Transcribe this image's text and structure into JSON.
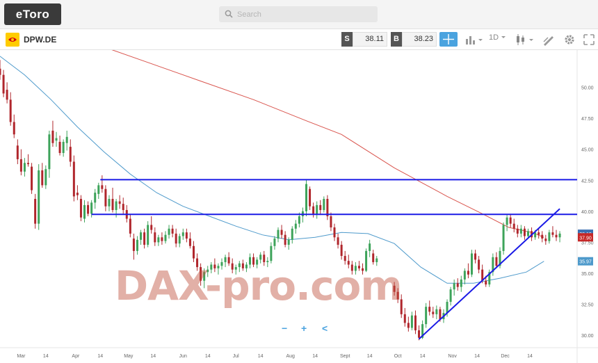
{
  "app": {
    "logo_text": "eToro"
  },
  "search": {
    "placeholder": "Search"
  },
  "instrument": {
    "symbol": "DPW.DE"
  },
  "trade": {
    "sell_label": "S",
    "sell_price": "38.11",
    "buy_label": "B",
    "buy_price": "38.23"
  },
  "toolbar": {
    "timeframe": "1D",
    "icons": [
      "crosshair-icon",
      "chart-type-icon",
      "candlestick-icon",
      "drawing-tool-icon",
      "settings-gear-icon",
      "expand-icon"
    ]
  },
  "watermark": {
    "text": "DAX-pro.com",
    "controls": [
      "−",
      "+",
      "<"
    ]
  },
  "colors": {
    "bull": "#3da35a",
    "bear": "#b0262c",
    "ma_short": "#4e9acb",
    "ma_long": "#d9544d",
    "trend": "#1a1ae6",
    "badge_price": "#c62828",
    "badge_last": "#3a6fb2",
    "badge_ma": "#4e9acb"
  },
  "chart_data": {
    "type": "candlestick",
    "ylim": [
      29.0,
      53.0
    ],
    "yticks": [
      "50.00",
      "47.50",
      "45.00",
      "42.50",
      "40.00",
      "37.50",
      "35.00",
      "32.50",
      "30.00"
    ],
    "ytick_values": [
      50,
      47.5,
      45,
      42.5,
      40,
      37.5,
      35,
      32.5,
      30
    ],
    "xticks": [
      "Mar",
      "14",
      "Apr",
      "14",
      "May",
      "14",
      "Jun",
      "14",
      "Jul",
      "14",
      "Aug",
      "14",
      "Sept",
      "14",
      "Oct",
      "14",
      "Nov",
      "14",
      "Dec",
      "14"
    ],
    "xtick_days": [
      28,
      42,
      59,
      73,
      89,
      103,
      120,
      134,
      150,
      164,
      181,
      195,
      212,
      226,
      242,
      256,
      273,
      287,
      303,
      317
    ],
    "x_range_days": [
      16,
      332
    ],
    "price_badges": [
      {
        "label": "38.19",
        "value": 38.19,
        "kind": "last"
      },
      {
        "label": "37.90",
        "value": 37.9,
        "kind": "price"
      },
      {
        "label": "35.97",
        "value": 35.97,
        "kind": "ma"
      }
    ],
    "horizontal_lines": [
      {
        "value": 42.55,
        "from_day": 73
      },
      {
        "value": 39.75,
        "from_day": 68
      }
    ],
    "trendline": {
      "from": [
        254,
        29.7
      ],
      "to": [
        334,
        40.2
      ]
    },
    "ma_short": [
      [
        16,
        52.5
      ],
      [
        30,
        51
      ],
      [
        45,
        49
      ],
      [
        60,
        46.8
      ],
      [
        75,
        44.8
      ],
      [
        90,
        43
      ],
      [
        105,
        41.5
      ],
      [
        120,
        40.4
      ],
      [
        135,
        39.6
      ],
      [
        150,
        38.8
      ],
      [
        165,
        38.1
      ],
      [
        180,
        37.7
      ],
      [
        195,
        37.9
      ],
      [
        210,
        38.3
      ],
      [
        225,
        38.2
      ],
      [
        240,
        37.4
      ],
      [
        255,
        35.5
      ],
      [
        270,
        34.2
      ],
      [
        285,
        34.2
      ],
      [
        300,
        34.6
      ],
      [
        315,
        35.1
      ],
      [
        325,
        35.97
      ]
    ],
    "ma_long": [
      [
        70,
        53.5
      ],
      [
        100,
        52
      ],
      [
        130,
        50.5
      ],
      [
        160,
        49
      ],
      [
        190,
        47.3
      ],
      [
        210,
        46.2
      ],
      [
        240,
        43.5
      ],
      [
        270,
        41.2
      ],
      [
        290,
        39.8
      ],
      [
        305,
        38.7
      ],
      [
        318,
        38.3
      ],
      [
        325,
        37.9
      ]
    ],
    "candles": [
      [
        16,
        51.5,
        52.2,
        50.6,
        51.0
      ],
      [
        18,
        51.0,
        51.4,
        49.2,
        49.5
      ],
      [
        20,
        49.8,
        50.4,
        48.7,
        49.0
      ],
      [
        22,
        49.0,
        49.6,
        46.9,
        47.2
      ],
      [
        24,
        47.2,
        47.8,
        45.9,
        46.2
      ],
      [
        26,
        45.3,
        45.8,
        43.8,
        44.2
      ],
      [
        28,
        44.2,
        45.0,
        42.9,
        43.2
      ],
      [
        30,
        43.2,
        44.3,
        42.8,
        43.9
      ],
      [
        32,
        43.9,
        44.6,
        43.6,
        43.8
      ],
      [
        34,
        43.6,
        43.9,
        41.4,
        41.7
      ],
      [
        36,
        41.0,
        41.4,
        38.6,
        39.0
      ],
      [
        38,
        39.0,
        43.8,
        38.5,
        43.3
      ],
      [
        40,
        43.3,
        43.9,
        41.9,
        42.1
      ],
      [
        42,
        42.1,
        43.7,
        41.8,
        43.4
      ],
      [
        44,
        43.4,
        46.5,
        42.7,
        46.2
      ],
      [
        46,
        46.5,
        47.3,
        45.2,
        45.5
      ],
      [
        48,
        45.7,
        46.4,
        45.2,
        45.9
      ],
      [
        50,
        45.6,
        46.1,
        44.5,
        44.7
      ],
      [
        52,
        44.7,
        45.8,
        44.4,
        45.6
      ],
      [
        54,
        45.5,
        46.5,
        44.9,
        46.0
      ],
      [
        56,
        45.2,
        45.8,
        43.6,
        44.0
      ],
      [
        58,
        44.0,
        44.5,
        40.8,
        41.2
      ],
      [
        60,
        41.5,
        42.1,
        40.9,
        41.3
      ],
      [
        62,
        41.0,
        41.3,
        39.2,
        39.5
      ],
      [
        64,
        39.4,
        40.9,
        39.1,
        40.5
      ],
      [
        66,
        40.5,
        40.8,
        39.6,
        39.8
      ],
      [
        68,
        39.8,
        40.9,
        39.5,
        40.7
      ],
      [
        70,
        40.7,
        41.8,
        40.2,
        41.5
      ],
      [
        72,
        41.4,
        42.3,
        41.0,
        42.1
      ],
      [
        74,
        42.1,
        42.9,
        41.5,
        41.8
      ],
      [
        76,
        41.8,
        42.1,
        40.0,
        40.4
      ],
      [
        78,
        40.4,
        41.3,
        40.0,
        41.0
      ],
      [
        80,
        41.0,
        41.9,
        39.9,
        40.1
      ],
      [
        82,
        40.1,
        41.0,
        39.5,
        40.8
      ],
      [
        84,
        40.8,
        41.3,
        40.2,
        40.6
      ],
      [
        86,
        40.6,
        41.1,
        39.8,
        40.1
      ],
      [
        88,
        40.1,
        40.5,
        39.1,
        39.4
      ],
      [
        90,
        39.4,
        39.8,
        37.9,
        38.2
      ],
      [
        92,
        37.8,
        38.2,
        36.1,
        36.8
      ],
      [
        94,
        36.8,
        38.0,
        36.5,
        37.7
      ],
      [
        96,
        37.7,
        38.5,
        37.3,
        38.3
      ],
      [
        98,
        38.3,
        38.6,
        37.0,
        37.3
      ],
      [
        100,
        37.3,
        39.2,
        37.1,
        38.9
      ],
      [
        102,
        38.9,
        39.6,
        38.2,
        38.5
      ],
      [
        104,
        38.3,
        38.7,
        37.2,
        37.5
      ],
      [
        106,
        37.5,
        38.1,
        37.2,
        37.9
      ],
      [
        108,
        37.9,
        38.3,
        37.3,
        37.6
      ],
      [
        110,
        37.6,
        38.4,
        37.4,
        38.1
      ],
      [
        112,
        38.1,
        38.9,
        37.8,
        38.6
      ],
      [
        114,
        38.6,
        38.9,
        37.9,
        38.2
      ],
      [
        116,
        38.2,
        38.6,
        37.1,
        37.4
      ],
      [
        118,
        37.4,
        38.2,
        37.1,
        38.0
      ],
      [
        120,
        38.0,
        38.6,
        37.7,
        38.3
      ],
      [
        122,
        38.3,
        38.6,
        37.5,
        37.8
      ],
      [
        124,
        37.8,
        38.3,
        37.0,
        37.2
      ],
      [
        126,
        37.2,
        37.6,
        35.9,
        36.2
      ],
      [
        128,
        36.2,
        36.6,
        35.2,
        35.5
      ],
      [
        130,
        35.5,
        35.8,
        34.0,
        34.4
      ],
      [
        132,
        34.4,
        35.4,
        33.8,
        35.1
      ],
      [
        134,
        35.1,
        35.6,
        34.7,
        35.3
      ],
      [
        136,
        35.3,
        35.9,
        35.0,
        35.7
      ],
      [
        138,
        35.7,
        36.2,
        35.1,
        35.4
      ],
      [
        140,
        35.4,
        35.8,
        34.9,
        35.6
      ],
      [
        142,
        35.6,
        36.2,
        35.3,
        35.9
      ],
      [
        144,
        35.9,
        36.5,
        35.5,
        36.3
      ],
      [
        146,
        36.3,
        36.7,
        35.6,
        35.8
      ],
      [
        148,
        35.8,
        36.2,
        35.0,
        35.3
      ],
      [
        150,
        35.3,
        35.7,
        34.9,
        35.5
      ],
      [
        152,
        35.5,
        36.0,
        35.1,
        35.8
      ],
      [
        154,
        35.8,
        36.1,
        35.2,
        35.4
      ],
      [
        156,
        35.4,
        35.9,
        35.1,
        35.7
      ],
      [
        158,
        35.7,
        36.6,
        35.4,
        36.3
      ],
      [
        160,
        36.3,
        36.6,
        35.5,
        35.7
      ],
      [
        162,
        35.7,
        36.3,
        35.4,
        36.1
      ],
      [
        164,
        36.1,
        36.7,
        35.8,
        36.5
      ],
      [
        166,
        36.5,
        36.8,
        35.6,
        35.9
      ],
      [
        168,
        35.9,
        36.3,
        35.5,
        36.0
      ],
      [
        170,
        36.0,
        37.5,
        35.8,
        37.2
      ],
      [
        172,
        37.2,
        38.0,
        36.9,
        37.8
      ],
      [
        174,
        37.8,
        38.7,
        37.5,
        38.5
      ],
      [
        176,
        38.5,
        38.9,
        37.8,
        38.1
      ],
      [
        178,
        38.1,
        38.4,
        37.1,
        37.3
      ],
      [
        180,
        37.3,
        37.9,
        36.9,
        37.7
      ],
      [
        182,
        37.7,
        38.8,
        37.4,
        38.6
      ],
      [
        184,
        38.6,
        39.3,
        38.2,
        39.0
      ],
      [
        186,
        39.0,
        39.9,
        38.7,
        39.6
      ],
      [
        188,
        39.6,
        40.3,
        39.1,
        40.0
      ],
      [
        190,
        40.0,
        42.6,
        39.6,
        42.2
      ],
      [
        192,
        41.8,
        42.0,
        40.1,
        40.4
      ],
      [
        194,
        40.4,
        40.7,
        39.5,
        39.8
      ],
      [
        196,
        39.8,
        40.8,
        39.4,
        40.5
      ],
      [
        198,
        40.5,
        40.9,
        39.7,
        40.1
      ],
      [
        200,
        40.1,
        41.2,
        39.9,
        41.0
      ],
      [
        202,
        41.0,
        41.3,
        39.3,
        39.6
      ],
      [
        204,
        39.6,
        39.9,
        38.4,
        38.7
      ],
      [
        206,
        38.7,
        39.0,
        37.6,
        37.9
      ],
      [
        208,
        37.9,
        38.2,
        37.0,
        37.3
      ],
      [
        210,
        37.3,
        37.6,
        36.1,
        36.4
      ],
      [
        212,
        36.4,
        36.8,
        35.7,
        36.0
      ],
      [
        214,
        36.0,
        36.5,
        35.4,
        35.7
      ],
      [
        216,
        35.7,
        36.0,
        34.9,
        35.2
      ],
      [
        218,
        35.2,
        35.9,
        34.9,
        35.6
      ],
      [
        220,
        35.6,
        36.0,
        35.2,
        35.4
      ],
      [
        222,
        35.4,
        35.8,
        34.9,
        35.2
      ],
      [
        224,
        35.2,
        37.0,
        35.1,
        36.8
      ],
      [
        226,
        36.8,
        37.7,
        36.3,
        37.4
      ],
      [
        228,
        36.6,
        36.9,
        35.7,
        35.9
      ],
      [
        230,
        35.9,
        36.4,
        35.6,
        36.2
      ],
      [
        240,
        34.0,
        34.3,
        33.2,
        33.5
      ],
      [
        242,
        33.5,
        33.8,
        32.6,
        32.9
      ],
      [
        244,
        32.9,
        33.3,
        31.4,
        31.7
      ],
      [
        246,
        31.7,
        32.2,
        30.7,
        31.0
      ],
      [
        248,
        31.0,
        31.5,
        30.3,
        30.6
      ],
      [
        250,
        30.6,
        31.9,
        30.4,
        31.6
      ],
      [
        252,
        31.6,
        32.0,
        30.1,
        30.4
      ],
      [
        254,
        30.4,
        30.8,
        29.6,
        29.8
      ],
      [
        256,
        29.8,
        31.2,
        29.7,
        30.9
      ],
      [
        258,
        30.9,
        32.6,
        30.6,
        32.3
      ],
      [
        260,
        32.3,
        32.8,
        31.6,
        31.9
      ],
      [
        262,
        31.9,
        32.3,
        31.4,
        31.7
      ],
      [
        264,
        31.7,
        32.4,
        31.3,
        32.1
      ],
      [
        266,
        32.1,
        32.3,
        31.1,
        31.3
      ],
      [
        268,
        31.3,
        32.1,
        31.0,
        31.8
      ],
      [
        270,
        31.8,
        32.9,
        31.5,
        32.7
      ],
      [
        272,
        32.7,
        33.9,
        32.4,
        33.7
      ],
      [
        274,
        33.7,
        34.5,
        33.2,
        34.2
      ],
      [
        276,
        34.2,
        34.6,
        33.6,
        33.9
      ],
      [
        278,
        33.9,
        34.8,
        33.5,
        34.5
      ],
      [
        280,
        34.5,
        35.4,
        34.1,
        35.2
      ],
      [
        282,
        35.2,
        35.8,
        34.6,
        34.9
      ],
      [
        284,
        34.9,
        36.9,
        34.7,
        36.6
      ],
      [
        286,
        36.6,
        36.9,
        35.8,
        36.1
      ],
      [
        288,
        36.1,
        36.4,
        35.0,
        35.3
      ],
      [
        290,
        35.3,
        35.7,
        34.2,
        34.4
      ],
      [
        292,
        34.4,
        34.8,
        33.9,
        34.1
      ],
      [
        294,
        34.1,
        35.3,
        33.9,
        35.1
      ],
      [
        296,
        35.1,
        36.6,
        34.8,
        36.3
      ],
      [
        298,
        36.3,
        36.7,
        35.4,
        35.6
      ],
      [
        300,
        35.6,
        37.1,
        35.4,
        36.8
      ],
      [
        302,
        36.8,
        39.1,
        36.5,
        38.9
      ],
      [
        304,
        38.9,
        39.7,
        38.4,
        39.5
      ],
      [
        306,
        39.5,
        39.8,
        38.7,
        39.0
      ],
      [
        308,
        39.0,
        39.4,
        38.3,
        38.6
      ],
      [
        310,
        38.6,
        38.9,
        37.9,
        38.2
      ],
      [
        312,
        38.2,
        38.9,
        37.9,
        38.6
      ],
      [
        314,
        38.6,
        38.8,
        37.7,
        38.0
      ],
      [
        316,
        38.0,
        38.6,
        37.8,
        38.4
      ],
      [
        318,
        38.4,
        38.7,
        37.6,
        37.9
      ],
      [
        320,
        37.9,
        38.5,
        37.7,
        38.3
      ],
      [
        322,
        38.3,
        38.6,
        37.8,
        38.1
      ],
      [
        324,
        38.1,
        38.4,
        37.5,
        37.8
      ],
      [
        326,
        37.8,
        38.1,
        37.3,
        37.6
      ],
      [
        328,
        37.6,
        38.5,
        37.4,
        38.3
      ],
      [
        330,
        38.3,
        38.8,
        37.9,
        38.1
      ],
      [
        332,
        38.1,
        38.5,
        37.6,
        37.9
      ],
      [
        334,
        37.9,
        38.4,
        37.5,
        38.2
      ]
    ]
  }
}
